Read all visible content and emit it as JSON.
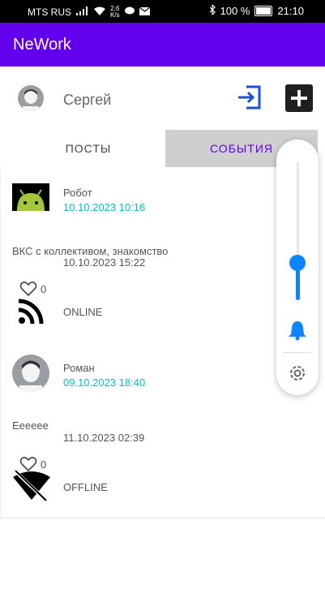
{
  "status_bar": {
    "carrier": "MTS RUS",
    "speed": "2,6",
    "speed_unit": "K/s",
    "battery": "100 %",
    "time": "21:10"
  },
  "app": {
    "title": "NeWork"
  },
  "header": {
    "user_name": "Сергей"
  },
  "tabs": [
    {
      "label": "ПОСТЫ",
      "selected": false
    },
    {
      "label": "СОБЫТИЯ",
      "selected": true
    }
  ],
  "events": [
    {
      "author": "Робот",
      "published": "10.10.2023 10:16",
      "content": "ВКС с коллективом, знакомство",
      "datetime": "10.10.2023 15:22",
      "likes": "0",
      "type": "ONLINE"
    },
    {
      "author": "Роман",
      "published": "09.10.2023 18:40",
      "content": "Ееееее",
      "datetime": "11.10.2023 02:39",
      "likes": "0",
      "type": "OFFLINE"
    }
  ],
  "volume_panel": {
    "level": 0.27
  },
  "colors": {
    "primary": "#6200EE",
    "date": "#00BCD4",
    "volume_accent": "#0a84ff"
  }
}
